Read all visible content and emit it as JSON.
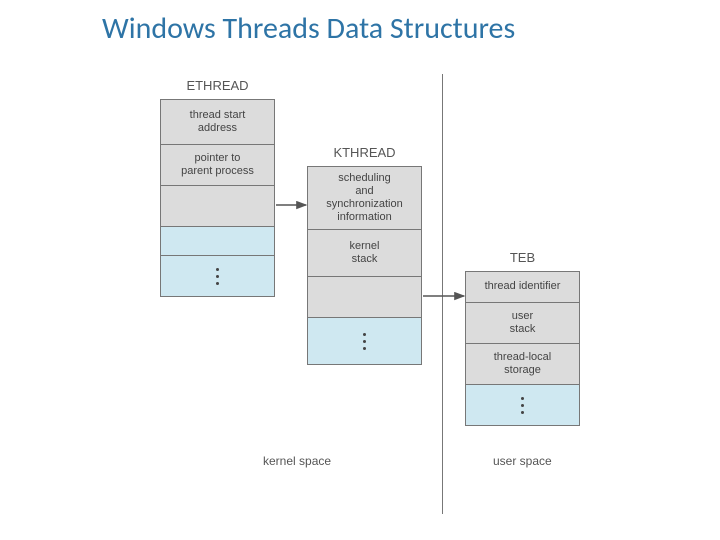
{
  "title": "Windows Threads Data Structures",
  "diagram": {
    "columns": [
      {
        "label": "ETHREAD",
        "cells": [
          "thread start\naddress",
          "pointer to\nparent process",
          "",
          "",
          "dots"
        ]
      },
      {
        "label": "KTHREAD",
        "cells": [
          "scheduling\nand\nsynchronization\ninformation",
          "kernel\nstack",
          "",
          "dots"
        ]
      },
      {
        "label": "TEB",
        "cells": [
          "thread  identifier",
          "user\nstack",
          "thread-local\nstorage",
          "dots"
        ]
      }
    ],
    "space_labels": {
      "kernel": "kernel space",
      "user": "user space"
    }
  }
}
